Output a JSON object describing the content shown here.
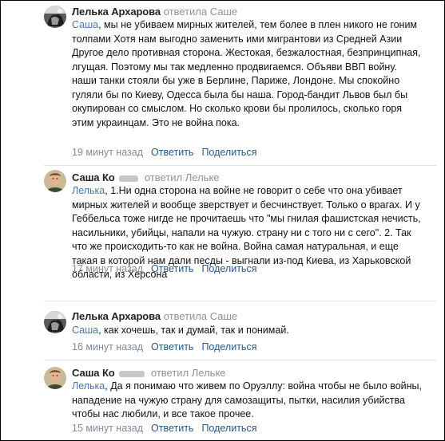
{
  "comments": [
    {
      "author": "Лелька Архарова",
      "replied_label": "ответила Саше",
      "addressee": "Саша",
      "body": ", мы не убиваем мирных жителей, тем более в плен никого не гоним толпами Хотя нам выгодно заменить ими мигрантови из Средней Азии Другое дело противная сторона. Жестокая, безжалостная, безпринципная, лгущая. Поэтому мы так медленно продвигаемся. Объяви ВВП войну. наши танки стояли бы уже в Берлине, Париже, Лондоне. Мы спокойно гуляли бы по Киеву, Одесса была бы наша. Город-бандит Львов был бы окупирован со смыслом. Но сколько крови бы пролилось, сколько горя этим украинцам. Это не война пока.",
      "time": "19 минут назад",
      "reply": "Ответить",
      "share": "Поделиться"
    },
    {
      "author": "Саша Ко",
      "replied_label": "ответил Лельке",
      "addressee": "Лелька",
      "body": ", 1.Ни одна сторона на войне не говорит о себе что она убивает мирных жителей и вообще зверствует и бесчинствует. Только о врагах. И у Геббельса тоже нигде не прочитаешь что \"мы гнилая фашистская нечисть, насильники, убийцы, напали на чужую. страну ни с того ни с сего\". 2. Так что же происходить-то как не война. Война самая натуральная, и еще такая в которой нам дали песды - выгнали из-под Киева, из Харьковской области, из Херсона",
      "time": "17 минут назад",
      "reply": "Ответить",
      "share": "Поделиться"
    },
    {
      "author": "Лелька Архарова",
      "replied_label": "ответила Саше",
      "addressee": "Саша",
      "body": ", как хочешь, так и думай, так и понимай.",
      "time": "16 минут назад",
      "reply": "Ответить",
      "share": "Поделиться"
    },
    {
      "author": "Саша Ко",
      "replied_label": "ответил Лельке",
      "addressee": "Лелька",
      "body": ", Да я понимаю что живем по Оруэллу: война чтобы не было войны, нападение на чужую страну для самозащиты, пытки, насилия убийства чтобы нас любили, и все такое прочее.",
      "time": "15 минут назад",
      "reply": "Ответить",
      "share": "Поделиться"
    }
  ]
}
